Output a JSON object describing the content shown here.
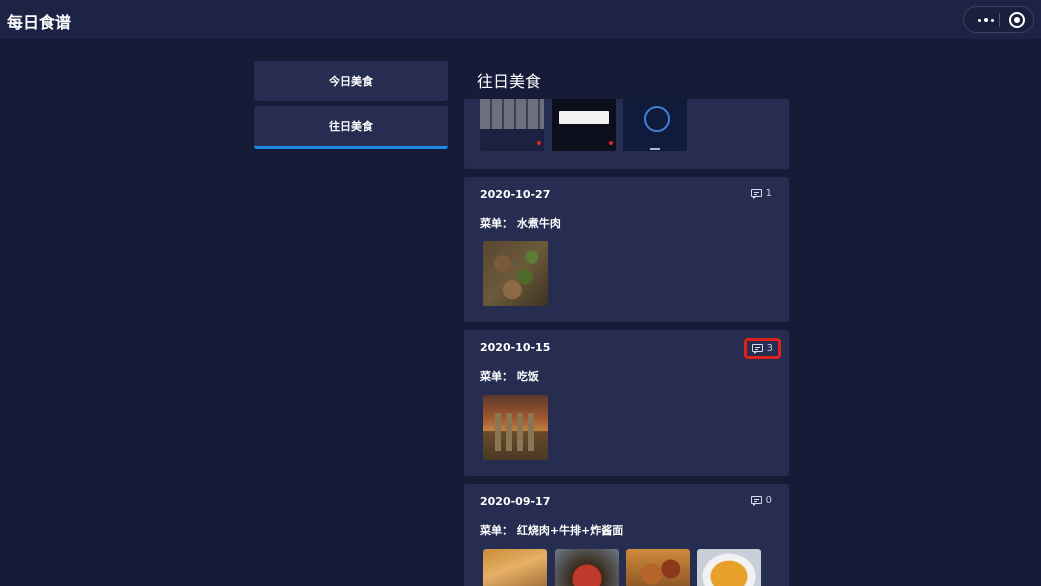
{
  "app": {
    "title": "每日食谱"
  },
  "nav": {
    "today_label": "今日美食",
    "past_label": "往日美食"
  },
  "section": {
    "title": "往日美食"
  },
  "menu_prefix": "菜单：",
  "entries": [
    {
      "date": "2020-10-27",
      "comments": "1",
      "menu": "水煮牛肉"
    },
    {
      "date": "2020-10-15",
      "comments": "3",
      "menu": "吃饭"
    },
    {
      "date": "2020-09-17",
      "comments": "0",
      "menu": "红烧肉+牛排+炸酱面"
    }
  ],
  "colors": {
    "background": "#161b38",
    "card": "#262d50",
    "accent": "#1e88e5",
    "highlight": "#e0201a"
  }
}
